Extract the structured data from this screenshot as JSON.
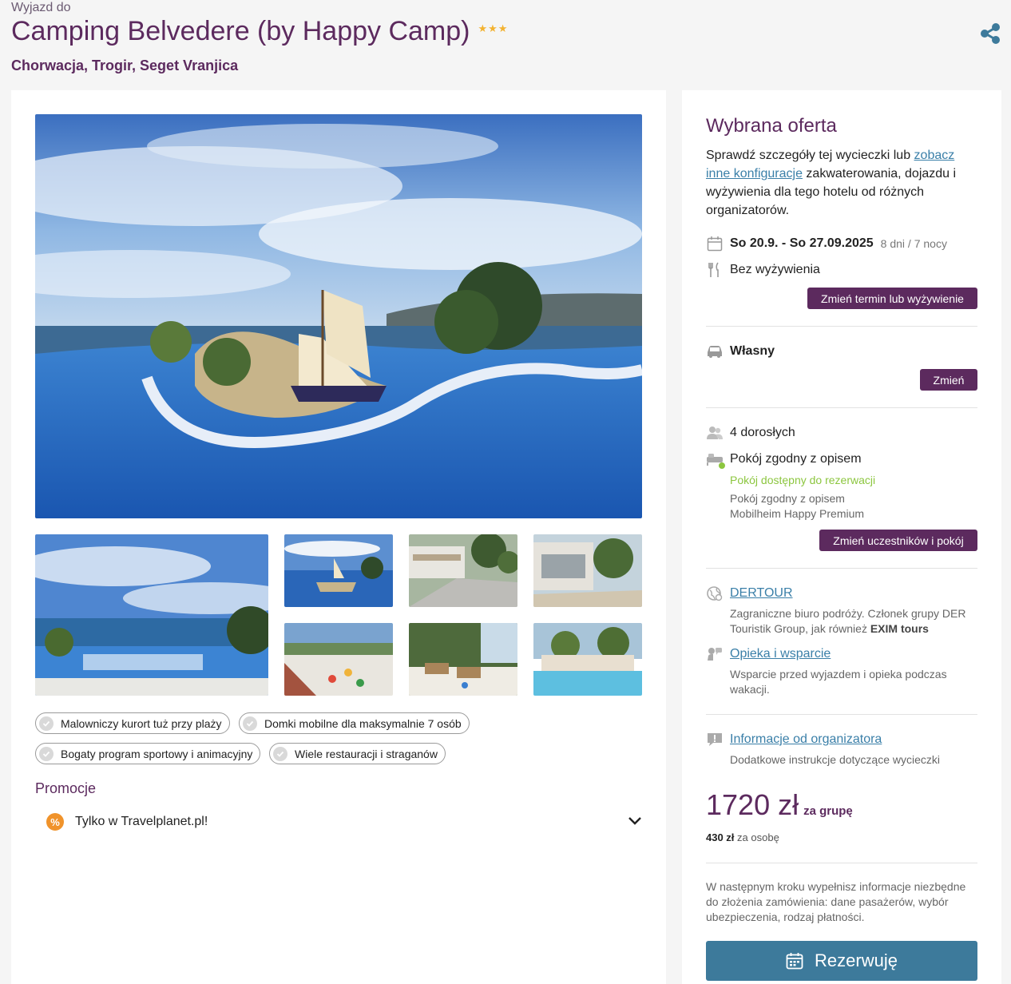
{
  "header": {
    "pre_title": "Wyjazd do",
    "title": "Camping Belvedere (by Happy Camp)",
    "stars": "★★★",
    "location": "Chorwacja, Trogir, Seget Vranjica"
  },
  "features": [
    "Malowniczy kurort tuż przy plaży",
    "Domki mobilne dla maksymalnie 7 osób",
    "Bogaty program sportowy i animacyjny",
    "Wiele restauracji i straganów"
  ],
  "promo": {
    "title": "Promocje",
    "item": "Tylko w Travelplanet.pl!"
  },
  "offer": {
    "title": "Wybrana oferta",
    "desc_before": "Sprawdź szczegóły tej wycieczki lub ",
    "desc_link": "zobacz inne konfiguracje",
    "desc_after": " zakwaterowania, dojazdu i wyżywienia dla tego hotelu od różnych organizatorów.",
    "dates": "So 20.9. - So 27.09.2025",
    "duration": "8 dni / 7 nocy",
    "board": "Bez wyżywienia",
    "change_term_btn": "Zmień termin lub wyżywienie",
    "transport": "Własny",
    "change_btn": "Zmień",
    "travelers": "4 dorosłych",
    "room": "Pokój zgodny z opisem",
    "room_available": "Pokój dostępny do rezerwacji",
    "room_desc": "Pokój zgodny z opisem",
    "room_type": "Mobilheim Happy Premium",
    "change_participants_btn": "Zmień uczestników i pokój",
    "organizer": "DERTOUR",
    "organizer_desc_1": "Zagraniczne biuro podróży. Członek grupy DER Touristik Group, jak również ",
    "organizer_desc_bold": "EXIM tours",
    "care_link": "Opieka i wsparcie",
    "care_desc": "Wsparcie przed wyjazdem i opieka podczas wakacji.",
    "info_link": "Informacje od organizatora",
    "info_desc": "Dodatkowe instrukcje dotyczące wycieczki",
    "price": "1720 zł",
    "price_unit": "za grupę",
    "per_person_amount": "430 zł",
    "per_person_label": "za osobę",
    "note": "W następnym kroku wypełnisz informacje niezbędne do złożenia zamówienia: dane pasażerów, wybór ubezpieczenia, rodzaj płatności.",
    "book_btn": "Rezerwuję"
  },
  "colors": {
    "brand": "#5c2a5e",
    "link": "#3a7fa8",
    "book": "#3d7a9b",
    "available": "#8cc63f",
    "promo": "#f0932b",
    "star": "#f3b230"
  }
}
